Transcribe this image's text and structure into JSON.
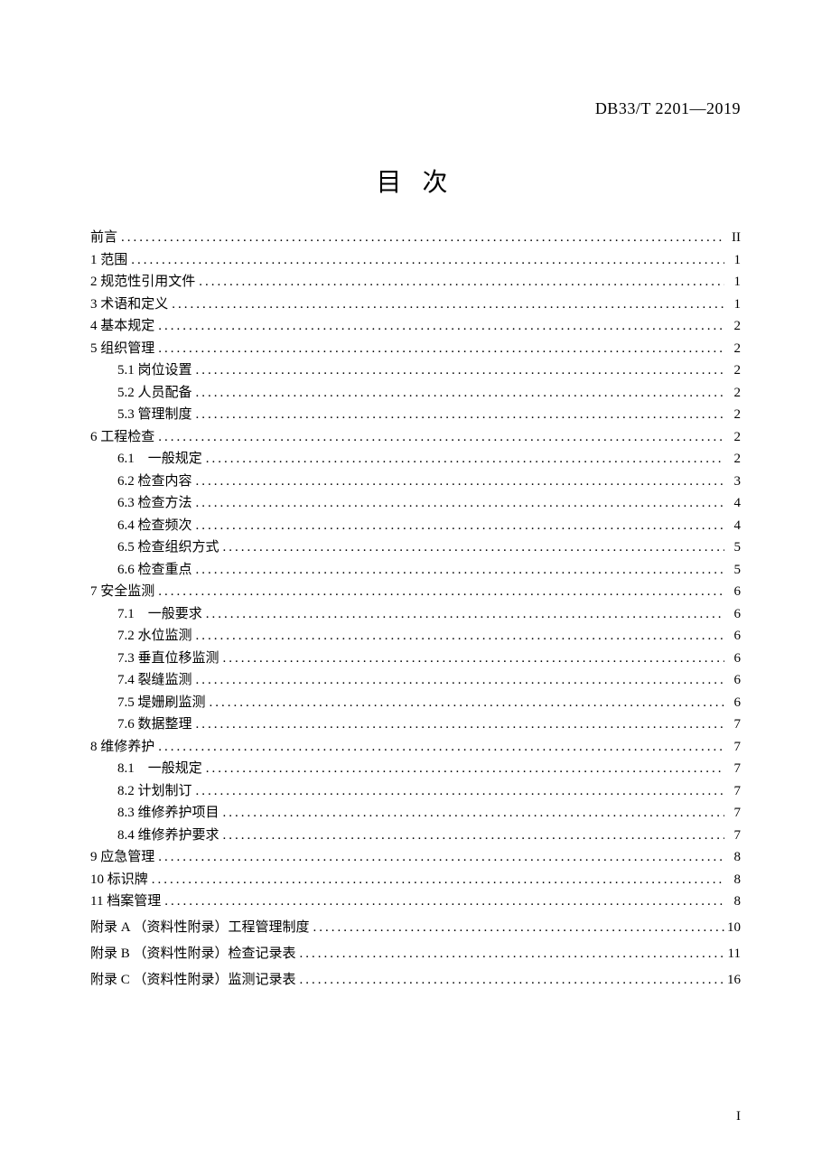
{
  "doc_id": "DB33/T 2201—2019",
  "title": "目 次",
  "page_number": "I",
  "toc": [
    {
      "label": "前言",
      "page": "II",
      "indent": false,
      "appendix": false
    },
    {
      "label": "1 范围",
      "page": "1",
      "indent": false,
      "appendix": false
    },
    {
      "label": "2 规范性引用文件",
      "page": "1",
      "indent": false,
      "appendix": false
    },
    {
      "label": "3 术语和定义",
      "page": "1",
      "indent": false,
      "appendix": false
    },
    {
      "label": "4 基本规定",
      "page": "2",
      "indent": false,
      "appendix": false
    },
    {
      "label": "5 组织管理",
      "page": "2",
      "indent": false,
      "appendix": false
    },
    {
      "label": "5.1 岗位设置",
      "page": "2",
      "indent": true,
      "appendix": false
    },
    {
      "label": "5.2 人员配备",
      "page": "2",
      "indent": true,
      "appendix": false
    },
    {
      "label": "5.3 管理制度",
      "page": "2",
      "indent": true,
      "appendix": false
    },
    {
      "label": "6 工程检查",
      "page": "2",
      "indent": false,
      "appendix": false
    },
    {
      "label": "6.1　一般规定",
      "page": "2",
      "indent": true,
      "appendix": false
    },
    {
      "label": "6.2 检查内容",
      "page": "3",
      "indent": true,
      "appendix": false
    },
    {
      "label": "6.3 检查方法",
      "page": "4",
      "indent": true,
      "appendix": false
    },
    {
      "label": "6.4 检查频次",
      "page": "4",
      "indent": true,
      "appendix": false
    },
    {
      "label": "6.5 检查组织方式",
      "page": "5",
      "indent": true,
      "appendix": false
    },
    {
      "label": "6.6 检查重点",
      "page": "5",
      "indent": true,
      "appendix": false
    },
    {
      "label": "7 安全监测",
      "page": "6",
      "indent": false,
      "appendix": false
    },
    {
      "label": "7.1　一般要求",
      "page": "6",
      "indent": true,
      "appendix": false
    },
    {
      "label": "7.2 水位监测",
      "page": "6",
      "indent": true,
      "appendix": false
    },
    {
      "label": "7.3 垂直位移监测",
      "page": "6",
      "indent": true,
      "appendix": false
    },
    {
      "label": "7.4 裂缝监测",
      "page": "6",
      "indent": true,
      "appendix": false
    },
    {
      "label": "7.5 堤姗刷监测",
      "page": "6",
      "indent": true,
      "appendix": false
    },
    {
      "label": "7.6 数据整理",
      "page": "7",
      "indent": true,
      "appendix": false
    },
    {
      "label": "8 维修养护",
      "page": "7",
      "indent": false,
      "appendix": false
    },
    {
      "label": "8.1　一般规定",
      "page": "7",
      "indent": true,
      "appendix": false
    },
    {
      "label": "8.2 计划制订",
      "page": "7",
      "indent": true,
      "appendix": false
    },
    {
      "label": "8.3 维修养护项目",
      "page": "7",
      "indent": true,
      "appendix": false
    },
    {
      "label": "8.4 维修养护要求",
      "page": "7",
      "indent": true,
      "appendix": false
    },
    {
      "label": "9 应急管理",
      "page": "8",
      "indent": false,
      "appendix": false
    },
    {
      "label": "10 标识牌",
      "page": "8",
      "indent": false,
      "appendix": false
    },
    {
      "label": "11 档案管理",
      "page": "8",
      "indent": false,
      "appendix": false
    },
    {
      "label": "附录 A （资料性附录）工程管理制度",
      "page": "10",
      "indent": false,
      "appendix": true
    },
    {
      "label": "附录 B （资料性附录）检查记录表",
      "page": "11",
      "indent": false,
      "appendix": true
    },
    {
      "label": "附录 C （资料性附录）监测记录表",
      "page": "16",
      "indent": false,
      "appendix": true
    }
  ]
}
